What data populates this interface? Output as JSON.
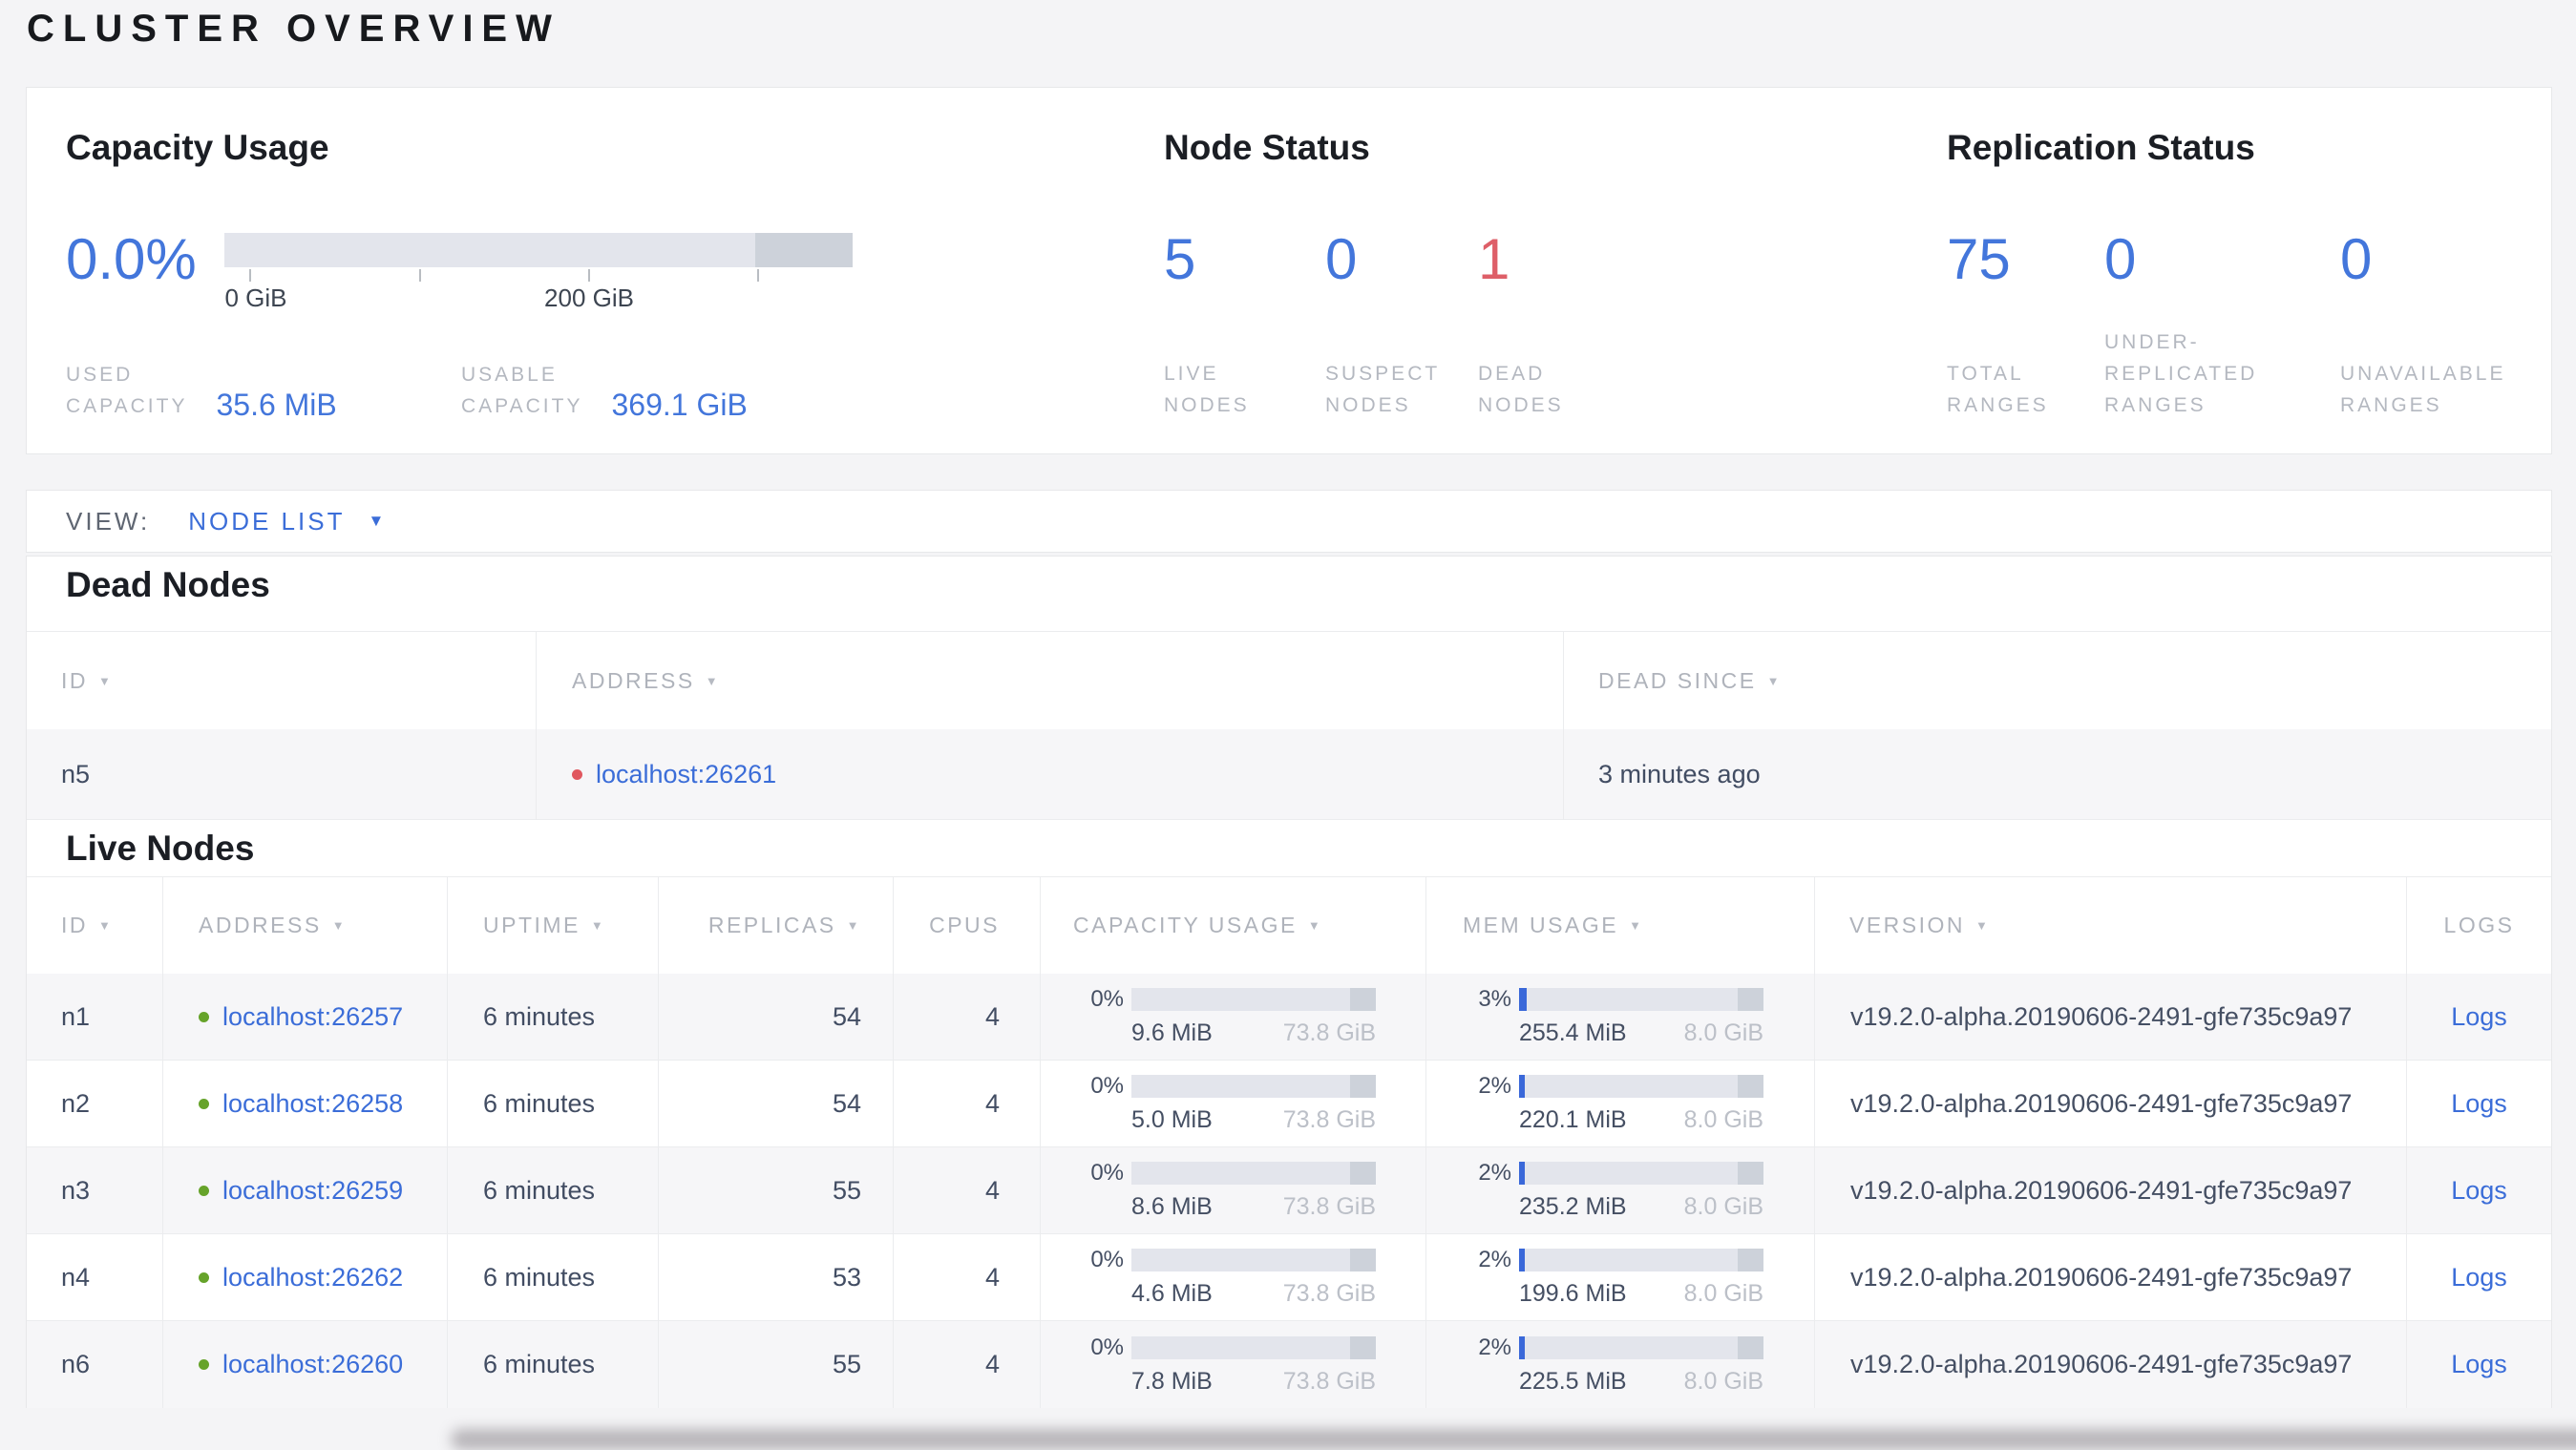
{
  "title": "CLUSTER OVERVIEW",
  "icons": {
    "sort_arrow": "▼",
    "dropdown_arrow": "▼"
  },
  "colors": {
    "accent_link_blue": "#3b6dd8",
    "stat_blue": "#4376db",
    "danger_red": "#de5f68",
    "live_dot_green": "#66a32a",
    "dead_dot_red": "#e0575f",
    "bar_track": "#e3e5ec",
    "bar_reserved": "#cdd2da",
    "bar_fill_blue": "#3a68d9",
    "caps_label_gray": "#b4b8c0",
    "body_text": "#424d63",
    "page_background": "#f4f4f6",
    "card_border": "#e7e8ea"
  },
  "summary": {
    "capacity": {
      "heading": "Capacity Usage",
      "percent": "0.0%",
      "bar": {
        "reserved_pct": 15.5
      },
      "tick_labels": {
        "first": "0 GiB",
        "third": "200 GiB"
      },
      "stats": [
        {
          "label_line1": "USED",
          "label_line2": "CAPACITY",
          "value": "35.6 MiB"
        },
        {
          "label_line1": "USABLE",
          "label_line2": "CAPACITY",
          "value": "369.1 GiB"
        }
      ]
    },
    "node_status": {
      "heading": "Node Status",
      "stats": [
        {
          "value": "5",
          "line1": "LIVE",
          "line2": "NODES"
        },
        {
          "value": "0",
          "line1": "SUSPECT",
          "line2": "NODES"
        },
        {
          "value": "1",
          "line1": "DEAD",
          "line2": "NODES"
        }
      ]
    },
    "replication": {
      "heading": "Replication Status",
      "stats": [
        {
          "value": "75",
          "line1": "TOTAL",
          "line2": "RANGES"
        },
        {
          "value": "0",
          "line0": "UNDER-",
          "line1": "REPLICATED",
          "line2": "RANGES"
        },
        {
          "value": "0",
          "line1": "UNAVAILABLE",
          "line2": "RANGES"
        }
      ]
    }
  },
  "view_bar": {
    "label": "VIEW:",
    "selected": "NODE LIST"
  },
  "dead_nodes": {
    "heading": "Dead Nodes",
    "columns": [
      {
        "label": "ID"
      },
      {
        "label": "ADDRESS"
      },
      {
        "label": "DEAD SINCE"
      }
    ],
    "rows": [
      {
        "id": "n5",
        "address": "localhost:26261",
        "dead_since": "3 minutes ago"
      }
    ]
  },
  "live_nodes": {
    "heading": "Live Nodes",
    "columns": [
      {
        "label": "ID"
      },
      {
        "label": "ADDRESS"
      },
      {
        "label": "UPTIME"
      },
      {
        "label": "REPLICAS"
      },
      {
        "label": "CPUS"
      },
      {
        "label": "CAPACITY USAGE"
      },
      {
        "label": "MEM USAGE"
      },
      {
        "label": "VERSION"
      },
      {
        "label": "LOGS"
      }
    ],
    "rows": [
      {
        "id": "n1",
        "address": "localhost:26257",
        "uptime": "6 minutes",
        "replicas": "54",
        "cpus": "4",
        "capacity": {
          "percent": "0%",
          "fill_pct": 0,
          "reserved_pct": 10.5,
          "used": "9.6 MiB",
          "total": "73.8 GiB"
        },
        "memory": {
          "percent": "3%",
          "fill_pct": 3,
          "reserved_pct": 10.5,
          "used": "255.4 MiB",
          "total": "8.0 GiB"
        },
        "version": "v19.2.0-alpha.20190606-2491-gfe735c9a97",
        "logs": "Logs"
      },
      {
        "id": "n2",
        "address": "localhost:26258",
        "uptime": "6 minutes",
        "replicas": "54",
        "cpus": "4",
        "capacity": {
          "percent": "0%",
          "fill_pct": 0,
          "reserved_pct": 10.5,
          "used": "5.0 MiB",
          "total": "73.8 GiB"
        },
        "memory": {
          "percent": "2%",
          "fill_pct": 2.5,
          "reserved_pct": 10.5,
          "used": "220.1 MiB",
          "total": "8.0 GiB"
        },
        "version": "v19.2.0-alpha.20190606-2491-gfe735c9a97",
        "logs": "Logs"
      },
      {
        "id": "n3",
        "address": "localhost:26259",
        "uptime": "6 minutes",
        "replicas": "55",
        "cpus": "4",
        "capacity": {
          "percent": "0%",
          "fill_pct": 0,
          "reserved_pct": 10.5,
          "used": "8.6 MiB",
          "total": "73.8 GiB"
        },
        "memory": {
          "percent": "2%",
          "fill_pct": 2.5,
          "reserved_pct": 10.5,
          "used": "235.2 MiB",
          "total": "8.0 GiB"
        },
        "version": "v19.2.0-alpha.20190606-2491-gfe735c9a97",
        "logs": "Logs"
      },
      {
        "id": "n4",
        "address": "localhost:26262",
        "uptime": "6 minutes",
        "replicas": "53",
        "cpus": "4",
        "capacity": {
          "percent": "0%",
          "fill_pct": 0,
          "reserved_pct": 10.5,
          "used": "4.6 MiB",
          "total": "73.8 GiB"
        },
        "memory": {
          "percent": "2%",
          "fill_pct": 2.5,
          "reserved_pct": 10.5,
          "used": "199.6 MiB",
          "total": "8.0 GiB"
        },
        "version": "v19.2.0-alpha.20190606-2491-gfe735c9a97",
        "logs": "Logs"
      },
      {
        "id": "n6",
        "address": "localhost:26260",
        "uptime": "6 minutes",
        "replicas": "55",
        "cpus": "4",
        "capacity": {
          "percent": "0%",
          "fill_pct": 0,
          "reserved_pct": 10.5,
          "used": "7.8 MiB",
          "total": "73.8 GiB"
        },
        "memory": {
          "percent": "2%",
          "fill_pct": 2.5,
          "reserved_pct": 10.5,
          "used": "225.5 MiB",
          "total": "8.0 GiB"
        },
        "version": "v19.2.0-alpha.20190606-2491-gfe735c9a97",
        "logs": "Logs"
      }
    ]
  }
}
